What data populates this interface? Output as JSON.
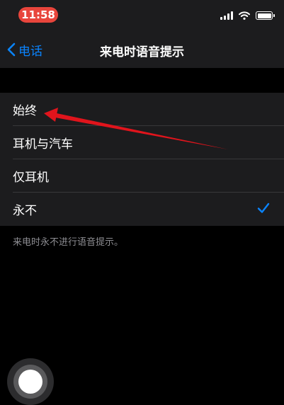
{
  "status_bar": {
    "time": "11:58",
    "time_pill_color": "#e8453c",
    "icons": [
      "signal-icon",
      "wifi-icon",
      "battery-icon"
    ]
  },
  "nav": {
    "back_label": "电话",
    "title": "来电时语音提示",
    "accent_color": "#0a84ff"
  },
  "options": [
    {
      "label": "始终",
      "selected": false
    },
    {
      "label": "耳机与汽车",
      "selected": false
    },
    {
      "label": "仅耳机",
      "selected": false
    },
    {
      "label": "永不",
      "selected": true
    }
  ],
  "footer_note": "来电时永不进行语音提示。",
  "annotation": {
    "icon": "red-arrow-icon",
    "color": "#e0141c"
  }
}
